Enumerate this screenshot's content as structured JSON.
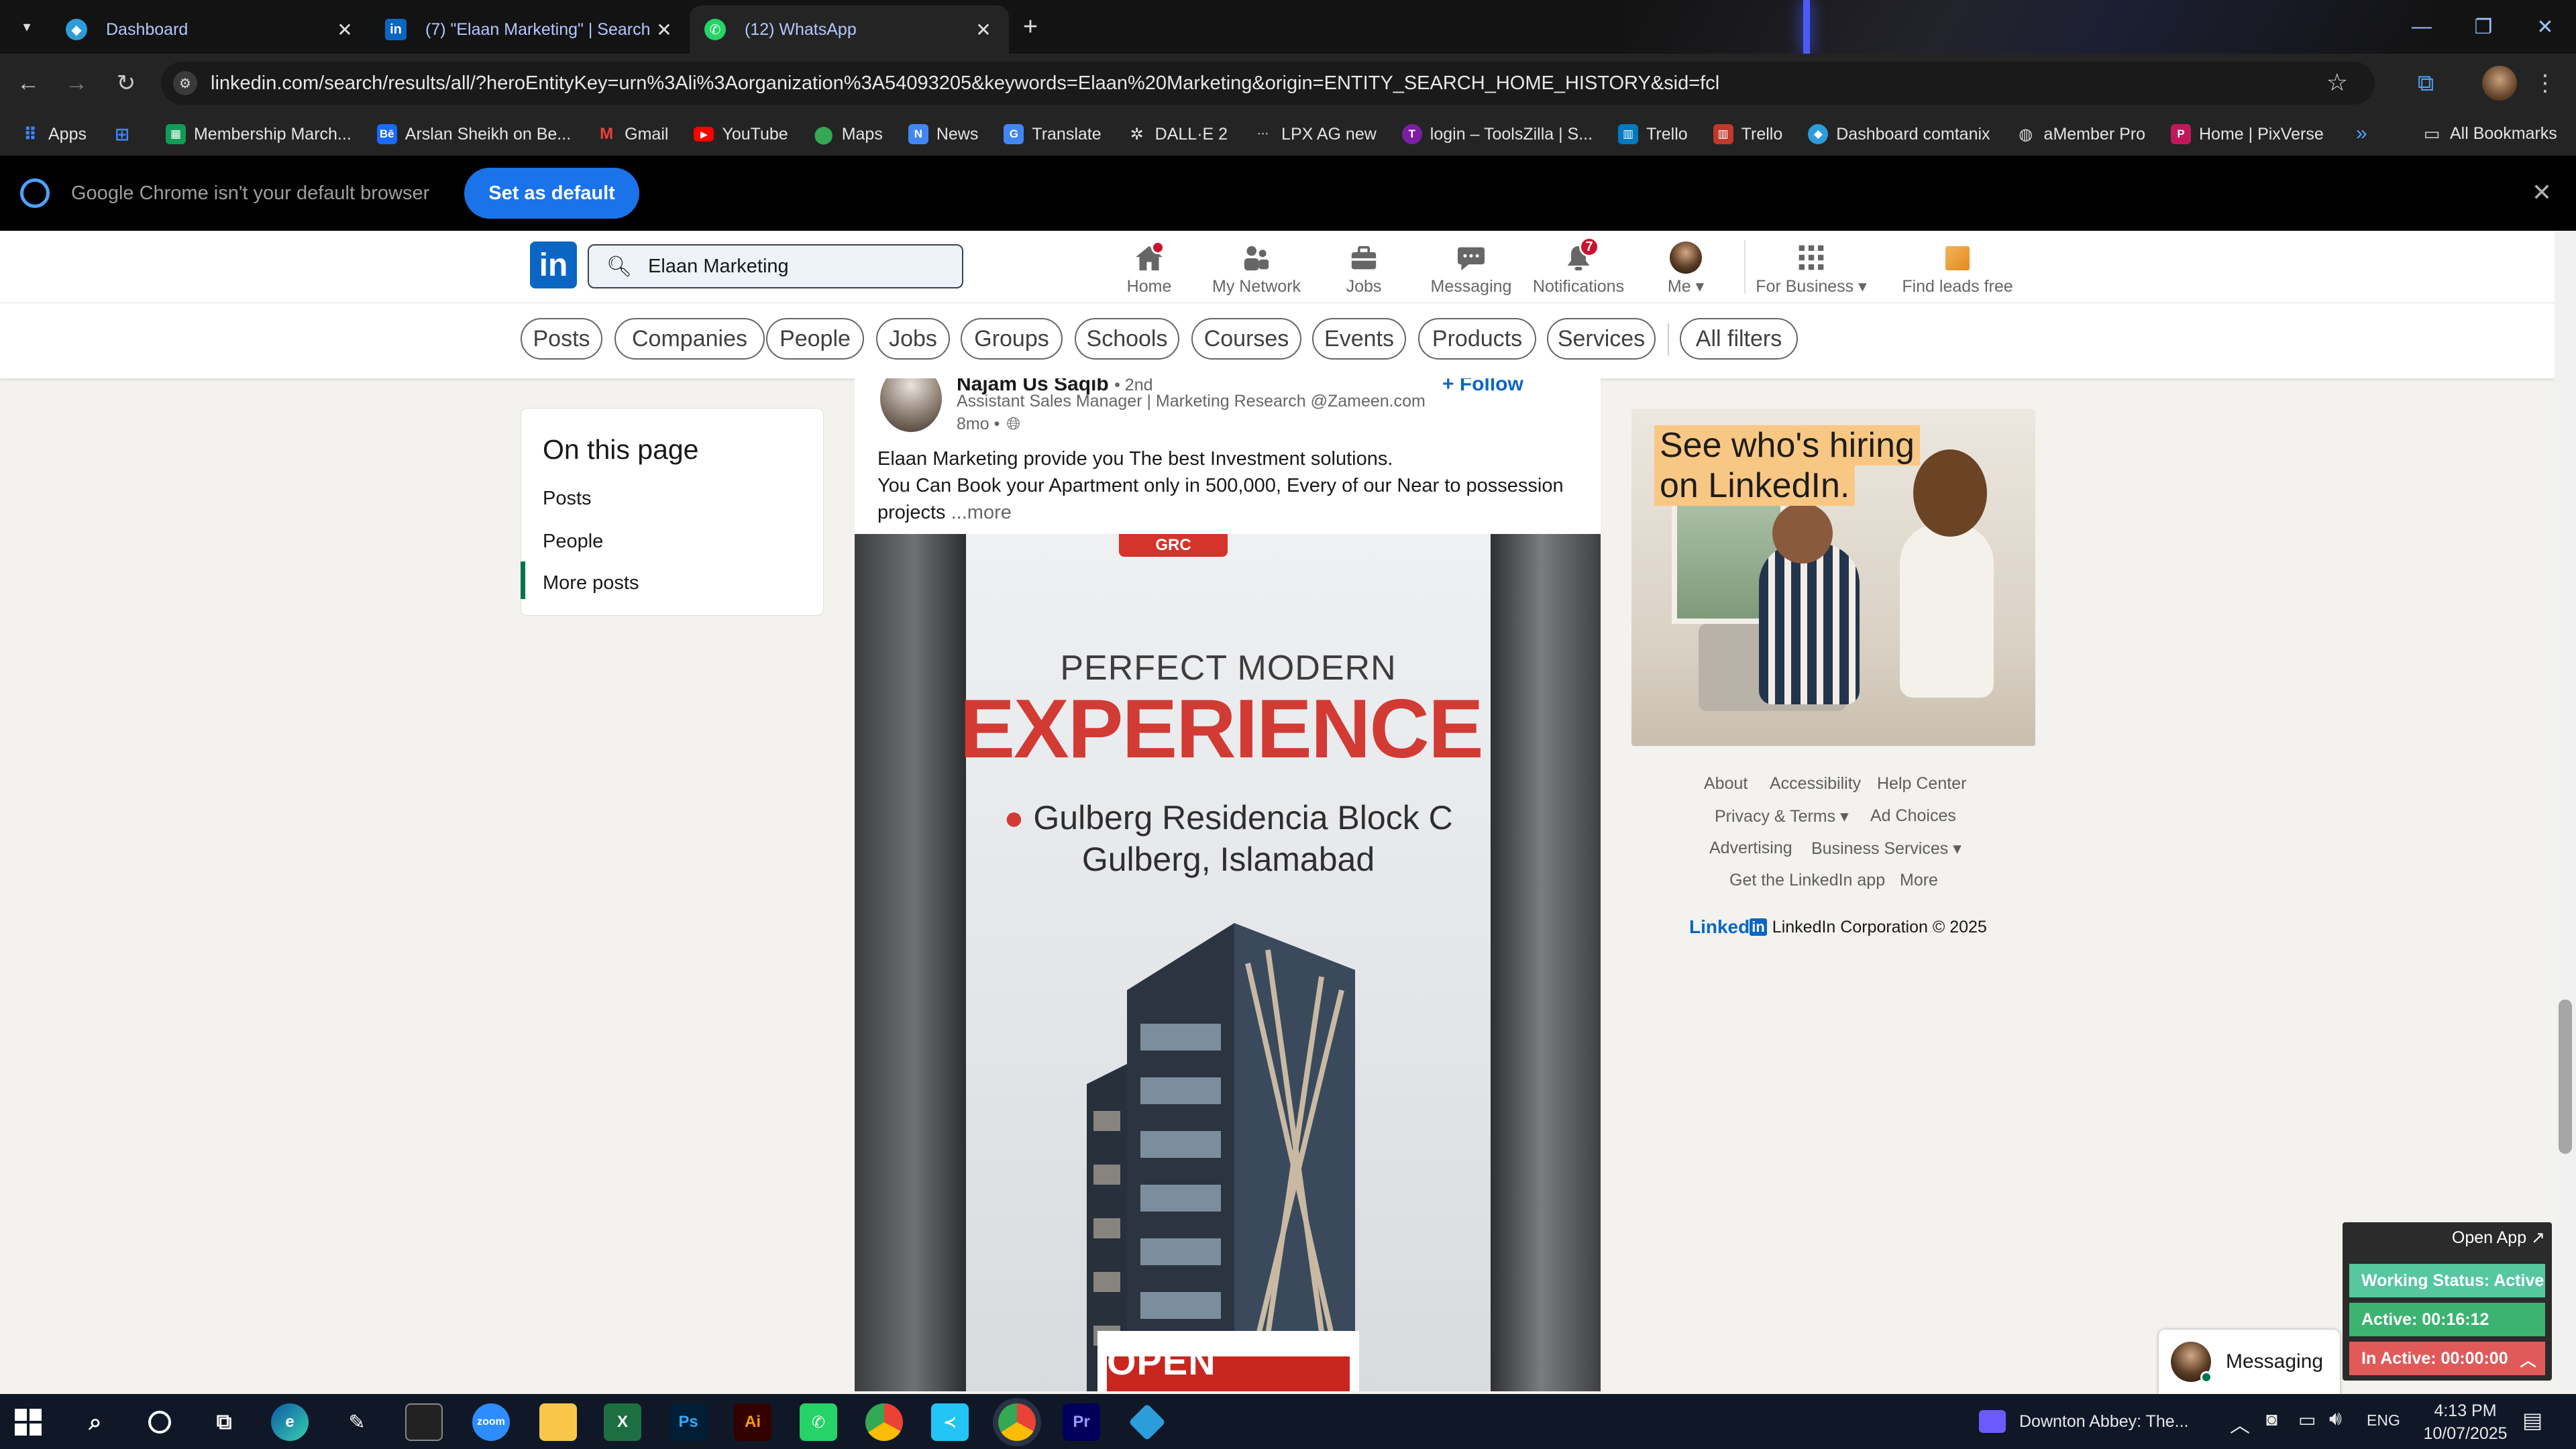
{
  "browser": {
    "tabs": [
      {
        "label": "Dashboard",
        "icon": "dashboard-icon",
        "color": "#2d9cdb"
      },
      {
        "label": "(7) \"Elaan Marketing\" | Search |",
        "icon": "linkedin-icon",
        "color": "#0a66c2"
      },
      {
        "label": "(12) WhatsApp",
        "icon": "whatsapp-icon",
        "color": "#25d366"
      }
    ],
    "url": "linkedin.com/search/results/all/?heroEntityKey=urn%3Ali%3Aorganization%3A54093205&keywords=Elaan%20Marketing&origin=ENTITY_SEARCH_HOME_HISTORY&sid=fcl",
    "bookmarks": [
      {
        "label": "Apps",
        "color": "#4285f4"
      },
      {
        "label": "",
        "color": "#4285f4"
      },
      {
        "label": "Membership March...",
        "color": "#0f9d58"
      },
      {
        "label": "Arslan Sheikh on Be...",
        "color": "#1769ff"
      },
      {
        "label": "Gmail",
        "color": "#ea4335"
      },
      {
        "label": "YouTube",
        "color": "#ff0000"
      },
      {
        "label": "Maps",
        "color": "#34a853"
      },
      {
        "label": "News",
        "color": "#4285f4"
      },
      {
        "label": "Translate",
        "color": "#4285f4"
      },
      {
        "label": "DALL·E 2",
        "color": "#555555"
      },
      {
        "label": "LPX AG new",
        "color": "#555555"
      },
      {
        "label": "login – ToolsZilla | S...",
        "color": "#7b1fa2"
      },
      {
        "label": "Trello",
        "color": "#0079bf"
      },
      {
        "label": "Trello",
        "color": "#0079bf"
      },
      {
        "label": "Dashboard comtanix",
        "color": "#2d9cdb"
      },
      {
        "label": "aMember Pro",
        "color": "#666666"
      },
      {
        "label": "Home | PixVerse",
        "color": "#c2185b"
      }
    ],
    "all_bookmarks": "All Bookmarks",
    "banner_text": "Google Chrome isn't your default browser",
    "banner_button": "Set as default"
  },
  "linkedin": {
    "logo": "in",
    "search_value": "Elaan Marketing",
    "nav": [
      {
        "label": "Home",
        "icon": "home-icon",
        "badge": ""
      },
      {
        "label": "My Network",
        "icon": "network-icon",
        "badge": ""
      },
      {
        "label": "Jobs",
        "icon": "briefcase-icon",
        "badge": ""
      },
      {
        "label": "Messaging",
        "icon": "messaging-icon",
        "badge": ""
      },
      {
        "label": "Notifications",
        "icon": "bell-icon",
        "badge": "7"
      },
      {
        "label": "Me",
        "icon": "avatar-icon",
        "badge": ""
      },
      {
        "label": "For Business",
        "icon": "grid-icon",
        "badge": ""
      },
      {
        "label": "Find leads free",
        "icon": "leads-icon",
        "badge": ""
      }
    ],
    "filters": [
      "Posts",
      "Companies",
      "People",
      "Jobs",
      "Groups",
      "Schools",
      "Courses",
      "Events",
      "Products",
      "Services",
      "All filters"
    ],
    "on_this_page": {
      "title": "On this page",
      "items": [
        "Posts",
        "People",
        "More posts"
      ]
    },
    "post": {
      "author": "Najam Us Saqib",
      "degree": "• 2nd",
      "headline": "Assistant Sales Manager | Marketing Research @Zameen.com",
      "time": "8mo •",
      "follow": "+ Follow",
      "text_line1": "Elaan Marketing provide you The best Investment solutions.",
      "text_line2": "You Can Book your Apartment only in 500,000, Every of our Near to possession",
      "text_line3": "projects",
      "more": "...more",
      "image": {
        "top_tag": "GRC",
        "headline1": "PERFECT MODERN",
        "headline2": "EXPERIENCE",
        "location1": "Gulberg Residencia Block C",
        "location2": "Gulberg, Islamabad",
        "bottom_banner": "OPEN HOUSE"
      }
    },
    "ad": {
      "line1": "See who's hiring",
      "line2": "on LinkedIn."
    },
    "footer": {
      "about": "About",
      "accessibility": "Accessibility",
      "help": "Help Center",
      "privacy": "Privacy & Terms",
      "adchoices": "Ad Choices",
      "advertising": "Advertising",
      "business": "Business Services",
      "getapp": "Get the LinkedIn app",
      "more": "More",
      "brand": "Linked",
      "brand_in": "in",
      "copyright": "LinkedIn Corporation © 2025"
    },
    "messaging_label": "Messaging"
  },
  "work_status": {
    "open_app": "Open App ↗",
    "status": "Working Status: Active",
    "active": "Active: 00:16:12",
    "inactive": "In Active: 00:00:00",
    "colors": {
      "status": "#57c7a0",
      "active": "#3cb371",
      "inactive": "#e05a5a"
    }
  },
  "taskbar": {
    "media": "Downton Abbey: The...",
    "lang": "ENG",
    "time": "4:13 PM",
    "date": "10/07/2025"
  }
}
